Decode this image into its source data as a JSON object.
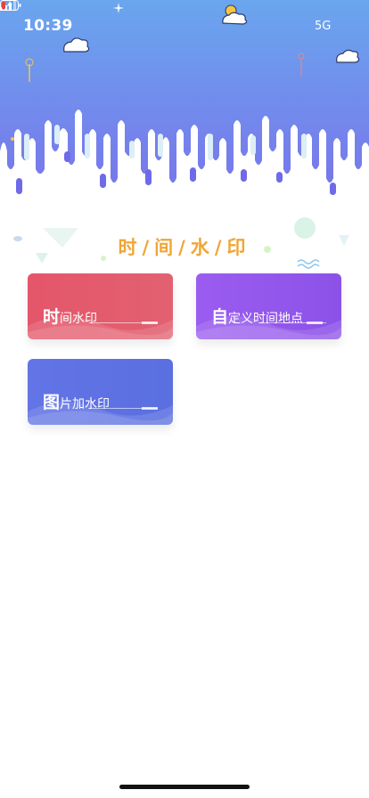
{
  "status_bar": {
    "time": "10:39",
    "network": "5G"
  },
  "page": {
    "title": "时/间/水/印"
  },
  "cards": [
    {
      "first_char": "时",
      "rest": "间水印",
      "color": "#e4566a"
    },
    {
      "first_char": "自",
      "rest": "定义时间地点",
      "color": "#9b5cf0"
    },
    {
      "first_char": "图",
      "rest": "片加水印",
      "color": "#6274e6"
    }
  ],
  "colors": {
    "header_top": "#6aa6ee",
    "header_bottom": "#7a70ea",
    "title": "#f0a535"
  }
}
